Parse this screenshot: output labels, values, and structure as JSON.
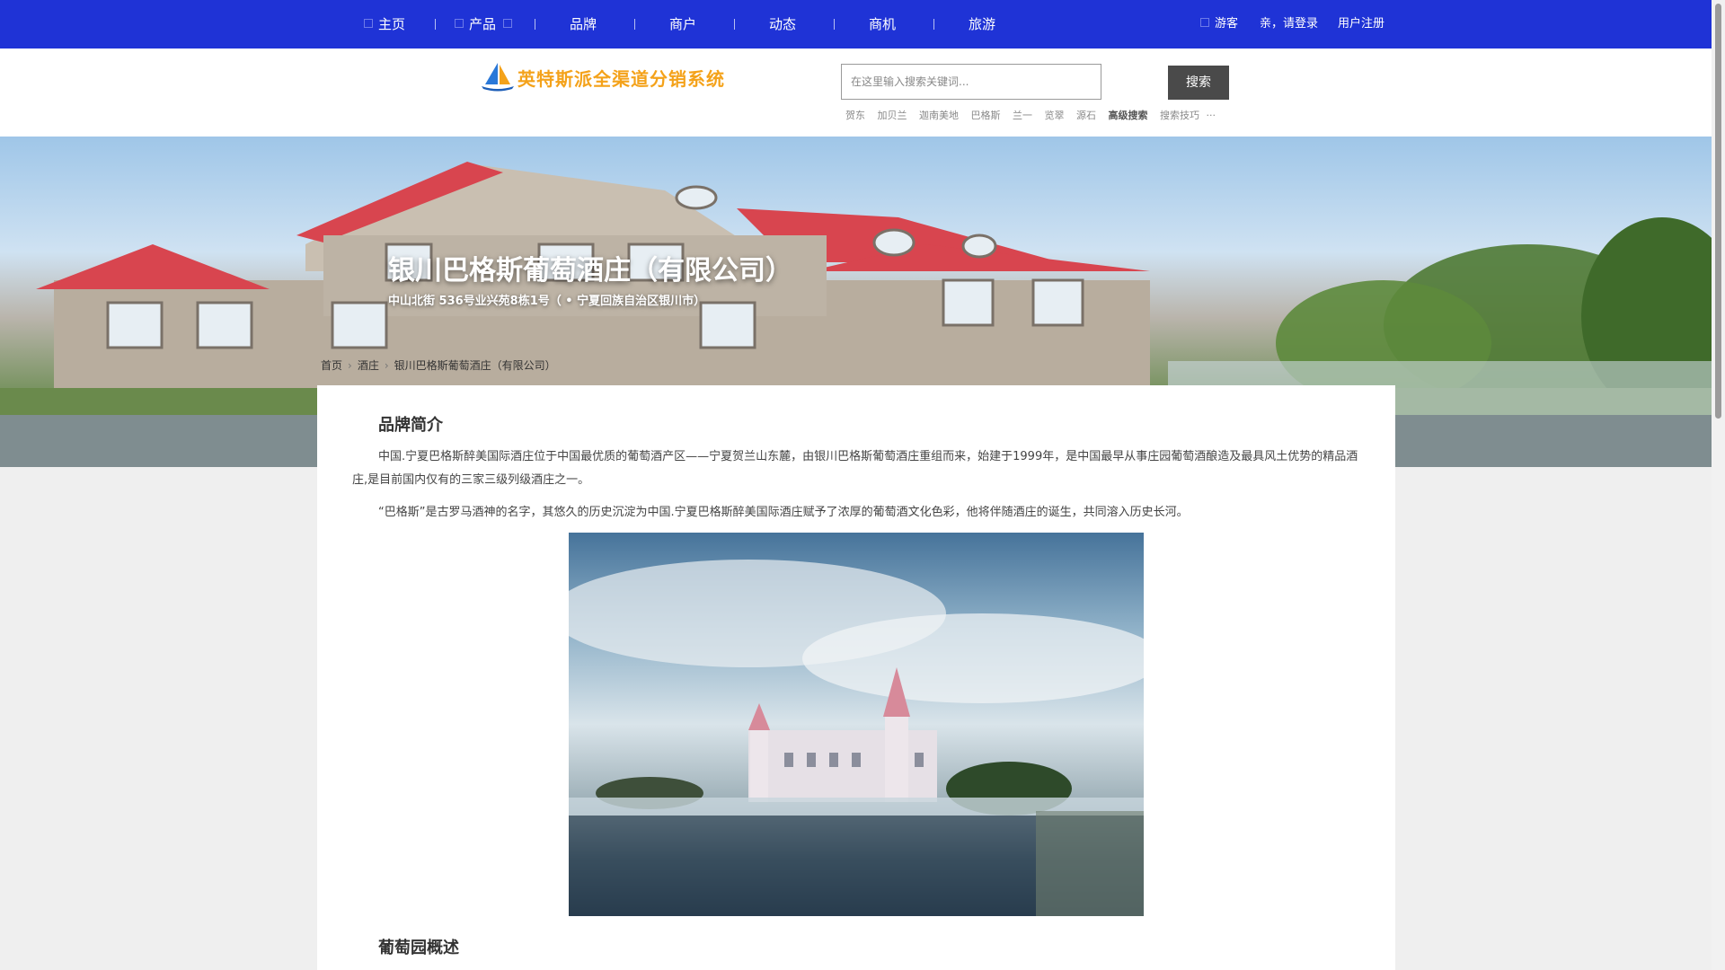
{
  "nav": {
    "items": [
      {
        "label": "主页"
      },
      {
        "label": "产品"
      },
      {
        "label": "品牌"
      },
      {
        "label": "商户"
      },
      {
        "label": "动态"
      },
      {
        "label": "商机"
      },
      {
        "label": "旅游"
      }
    ],
    "guest_label": "游客",
    "login_label": "亲，请登录",
    "register_label": "用户注册"
  },
  "header": {
    "logo_text": "英特斯派全渠道分销系统",
    "search_placeholder": "在这里输入搜索关键词...",
    "search_button": "搜索",
    "hot_words": [
      "贺东",
      "加贝兰",
      "迦南美地",
      "巴格斯",
      "兰一",
      "览翠",
      "源石"
    ],
    "advanced_search": "高级搜索",
    "search_tips": "搜索技巧",
    "more": "···"
  },
  "hero": {
    "title": "银川巴格斯葡萄酒庄（有限公司）",
    "address": "中山北街 536号业兴苑8栋1号（ • 宁夏回族自治区银川市）"
  },
  "breadcrumb": {
    "home": "首页",
    "category": "酒庄",
    "current": "银川巴格斯葡萄酒庄（有限公司）"
  },
  "content": {
    "section1_title": "品牌简介",
    "para1": "中国.宁夏巴格斯醉美国际酒庄位于中国最优质的葡萄酒产区——宁夏贺兰山东麓，由银川巴格斯葡萄酒庄重组而来，始建于1999年，是中国最早从事庄园葡萄酒酿造及最具风土优势的精品酒庄,是目前国内仅有的三家三级列级酒庄之一。",
    "para2": "“巴格斯”是古罗马酒神的名字，其悠久的历史沉淀为中国.宁夏巴格斯醉美国际酒庄赋予了浓厚的葡萄酒文化色彩，他将伴随酒庄的诞生，共同溶入历史长河。",
    "section2_title": "葡萄园概述"
  },
  "colors": {
    "nav_bg": "#1f33d6",
    "logo_orange": "#f4a21a",
    "search_button_bg": "#4a4a4a"
  }
}
